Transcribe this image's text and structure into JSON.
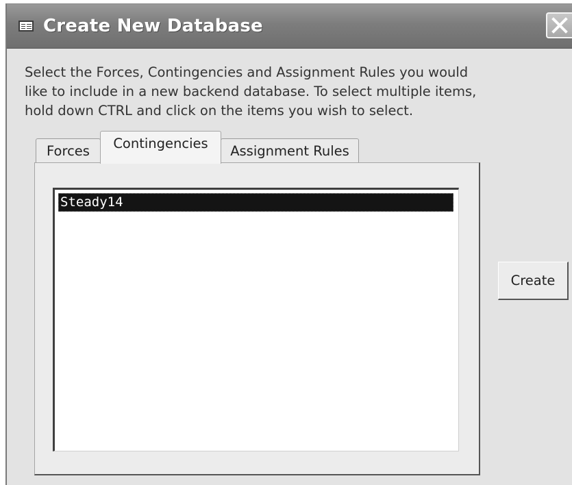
{
  "window": {
    "title": "Create New Database",
    "icon": "form-window-icon",
    "close_icon": "close-icon"
  },
  "instructions": "Select the Forces, Contingencies and Assignment Rules you would\nlike to include in a new backend database. To select multiple items,\nhold down CTRL and click on the items you wish to select.",
  "tabs": [
    {
      "label": "Forces",
      "active": false
    },
    {
      "label": "Contingencies",
      "active": true
    },
    {
      "label": "Assignment Rules",
      "active": false
    }
  ],
  "list": {
    "items": [
      {
        "label": "Steady14",
        "selected": true
      }
    ]
  },
  "actions": {
    "create_label": "Create"
  }
}
